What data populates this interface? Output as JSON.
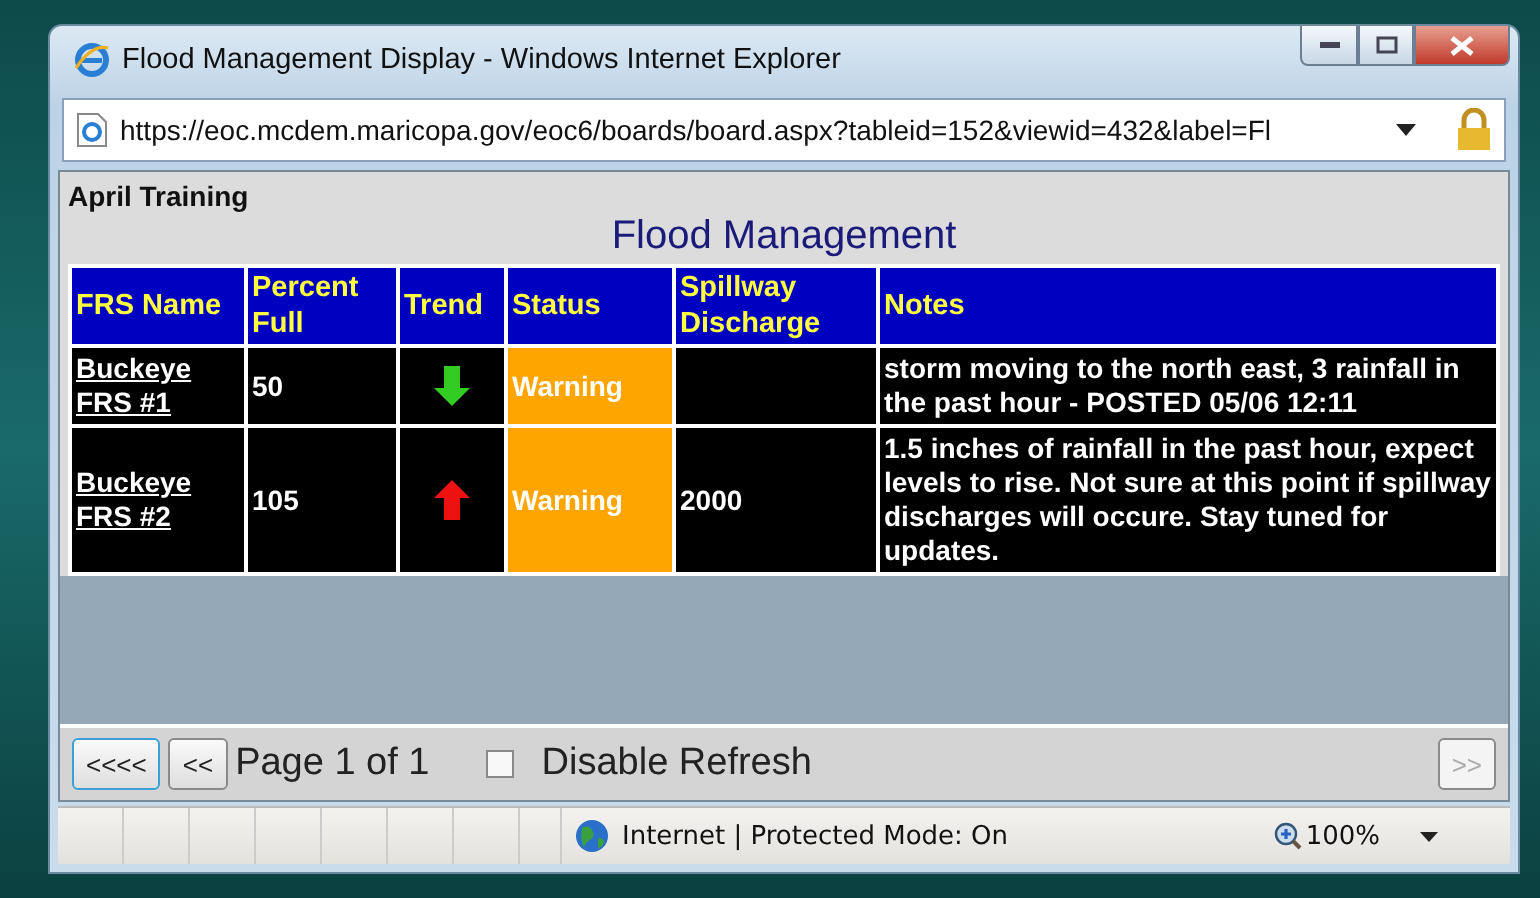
{
  "window": {
    "title": "Flood Management Display - Windows Internet Explorer"
  },
  "address_bar": {
    "url": "https://eoc.mcdem.maricopa.gov/eoc6/boards/board.aspx?tableid=152&viewid=432&label=Fl"
  },
  "board": {
    "name": "April Training",
    "title": "Flood Management"
  },
  "table": {
    "columns": [
      "FRS Name",
      "Percent Full",
      "Trend",
      "Status",
      "Spillway Discharge",
      "Notes"
    ],
    "rows": [
      {
        "name": "Buckeye FRS #1",
        "percent": "50",
        "rising": false,
        "status": "Warning",
        "discharge": "",
        "notes": "storm moving to the north east, 3 rainfall in the past hour - POSTED 05/06 12:11"
      },
      {
        "name": "Buckeye FRS #2",
        "percent": "105",
        "rising": true,
        "status": "Warning",
        "discharge": "2000",
        "notes": "1.5 inches of rainfall in the past hour, expect levels to rise. Not sure at this point if spillway discharges will occure. Stay tuned for updates."
      }
    ]
  },
  "pager": {
    "first": "<<<<",
    "prev": "<<",
    "page": "Page 1 of 1",
    "disable_refresh": {
      "label": "Disable Refresh",
      "checked": false
    },
    "next": {
      "label": ">>",
      "disabled": true
    }
  },
  "status_bar": {
    "zone": "Internet | Protected Mode: On",
    "zoom": "100%"
  }
}
